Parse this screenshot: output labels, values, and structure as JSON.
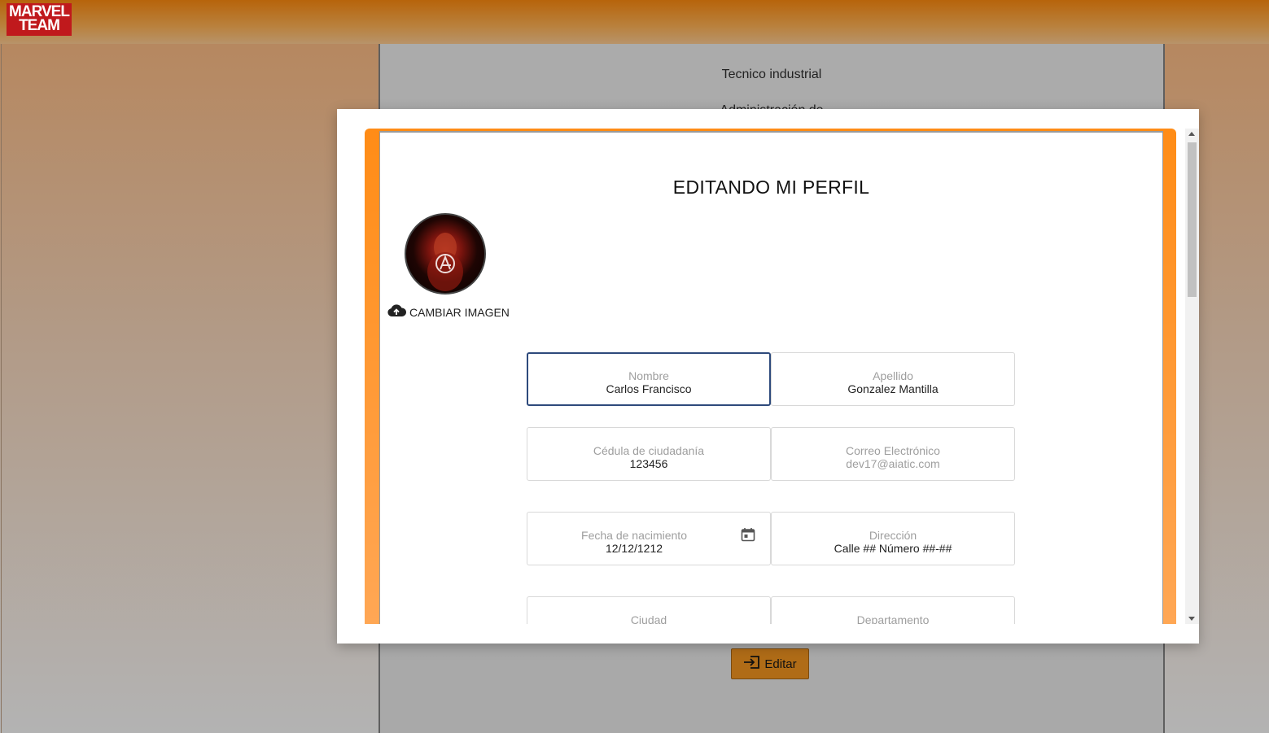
{
  "header": {
    "logo_line1": "MARVEL",
    "logo_line2": "TEAM"
  },
  "background": {
    "profession": "Tecnico industrial",
    "subtitle_partial": "Administración de",
    "edit_button_label": "Editar"
  },
  "modal": {
    "title": "EDITANDO MI PERFIL",
    "change_image_label": "CAMBIAR IMAGEN",
    "fields": {
      "nombre": {
        "label": "Nombre",
        "value": "Carlos Francisco"
      },
      "apellido": {
        "label": "Apellido",
        "value": "Gonzalez Mantilla"
      },
      "cedula": {
        "label": "Cédula de ciudadanía",
        "value": "123456"
      },
      "correo": {
        "label": "Correo Electrónico",
        "value": "dev17@aiatic.com"
      },
      "fecha": {
        "label": "Fecha de nacimiento",
        "value": "12/12/1212"
      },
      "direccion": {
        "label": "Dirección",
        "value": "Calle ## Número ##-##"
      },
      "ciudad": {
        "label": "Ciudad",
        "value": ""
      },
      "departamento": {
        "label": "Departamento",
        "value": ""
      }
    }
  },
  "colors": {
    "accent_orange": "#ff8c16",
    "focus_border": "#2e4a7c",
    "edit_button": "#b06c17"
  },
  "icons": [
    "cloud-upload-icon",
    "calendar-icon",
    "login-icon"
  ]
}
